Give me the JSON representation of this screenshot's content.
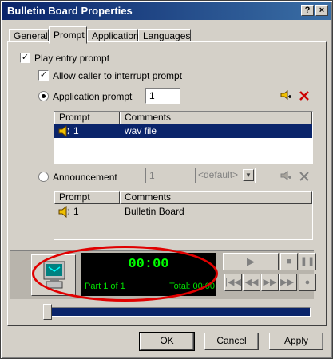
{
  "window": {
    "title": "Bulletin Board Properties",
    "help_label": "?",
    "close_label": "×"
  },
  "tabs": [
    {
      "label": "General"
    },
    {
      "label": "Prompt"
    },
    {
      "label": "Application"
    },
    {
      "label": "Languages"
    }
  ],
  "prompt": {
    "play_entry_label": "Play entry prompt",
    "play_entry_checked": "✓",
    "allow_interrupt_label": "Allow caller to interrupt prompt",
    "allow_interrupt_checked": "✓",
    "application_prompt_label": "Application prompt",
    "application_prompt_value": "1",
    "announcement_label": "Announcement",
    "announcement_value": "1",
    "announcement_language": "<default>"
  },
  "app_list": {
    "headers": [
      "Prompt",
      "Comments"
    ],
    "rows": [
      {
        "prompt": "1",
        "comment": "wav file"
      }
    ]
  },
  "ann_list": {
    "headers": [
      "Prompt",
      "Comments"
    ],
    "rows": [
      {
        "prompt": "1",
        "comment": "Bulletin Board"
      }
    ]
  },
  "player": {
    "time": "00:00",
    "part": "Part 1 of 1",
    "total": "Total: 00:00",
    "position_fraction": 0
  },
  "buttons": {
    "ok": "OK",
    "cancel": "Cancel",
    "apply": "Apply"
  },
  "icons": {
    "add_prompt": "add-prompt-icon",
    "delete_prompt": "delete-icon",
    "speaker": "speaker-icon",
    "computer": "computer-icon"
  },
  "colors": {
    "titlebar_start": "#0a246a",
    "titlebar_end": "#3a6ea5",
    "selection": "#0a246a",
    "display_text": "#00ff00",
    "delete_red": "#cc0000",
    "highlight_oval": "#e00000"
  }
}
